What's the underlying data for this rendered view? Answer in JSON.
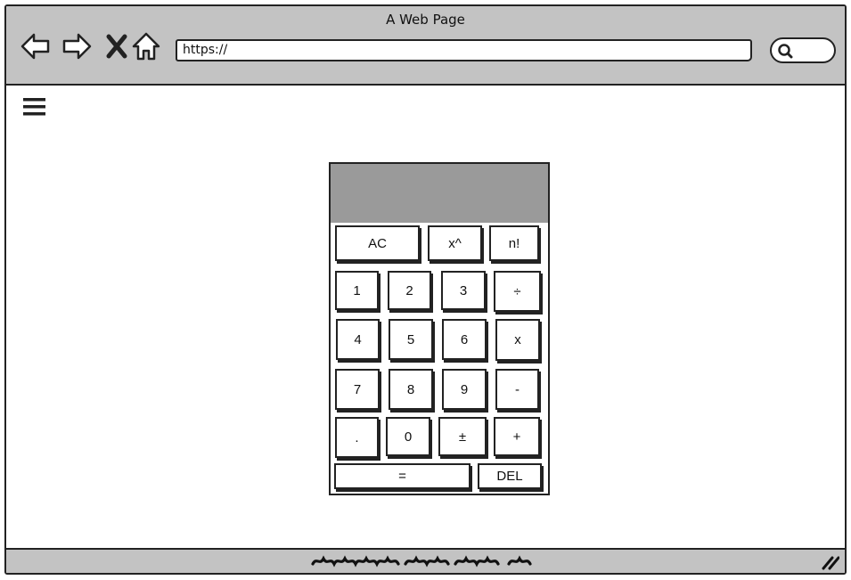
{
  "window": {
    "title": "A Web Page"
  },
  "toolbar": {
    "back_icon": "back-arrow-icon",
    "forward_icon": "forward-arrow-icon",
    "close_icon": "close-x-icon",
    "home_icon": "home-icon",
    "search_icon": "search-icon"
  },
  "address_bar": {
    "value": "https://"
  },
  "menu": {
    "icon": "hamburger-menu-icon"
  },
  "calculator": {
    "display_value": "",
    "keys": {
      "ac": "AC",
      "power": "x^",
      "factorial": "n!",
      "one": "1",
      "two": "2",
      "three": "3",
      "divide": "÷",
      "four": "4",
      "five": "5",
      "six": "6",
      "multiply": "x",
      "seven": "7",
      "eight": "8",
      "nine": "9",
      "minus": "-",
      "decimal": ".",
      "zero": "0",
      "plus_minus": "±",
      "plus": "+",
      "equals": "=",
      "delete": "DEL"
    }
  },
  "colors": {
    "chrome": "#c3c3c3",
    "display": "#9a9a9a",
    "outline": "#222222"
  }
}
